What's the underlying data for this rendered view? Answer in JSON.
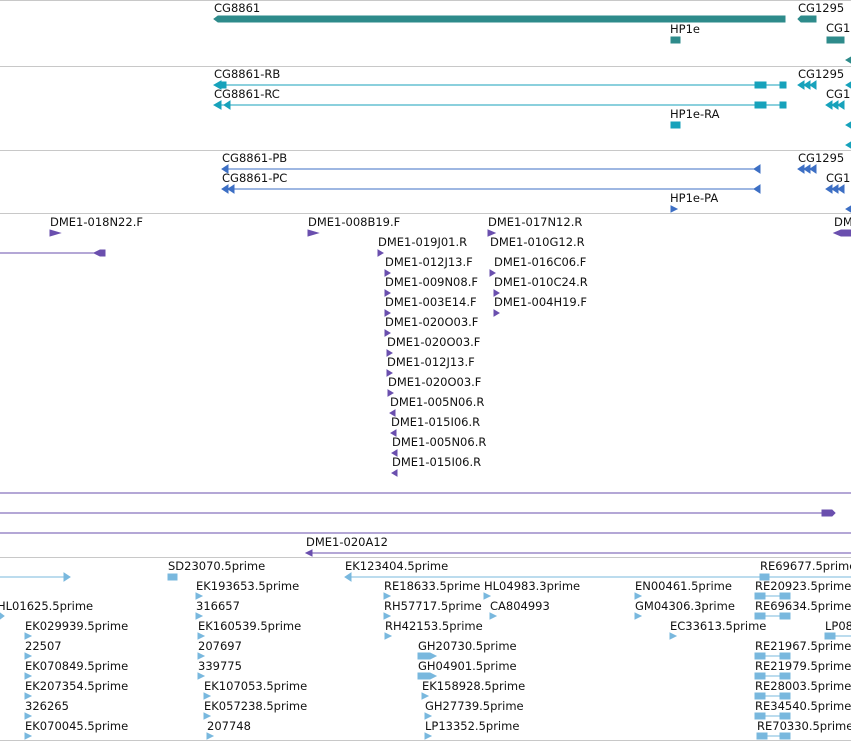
{
  "colors": {
    "gene": "#2e8b8b",
    "transcript": "#17a2bb",
    "protein": "#3d6fc4",
    "clone": "#6a4fae",
    "est": "#79b8de",
    "separator": "#c8c8c8"
  },
  "tracks": {
    "genes": {
      "labels": [
        {
          "id": "gene-cg8861",
          "text": "CG8861"
        },
        {
          "id": "gene-cg1295-a",
          "text": "CG1295"
        },
        {
          "id": "gene-hp1e",
          "text": "HP1e"
        },
        {
          "id": "gene-cg1-a",
          "text": "CG1"
        }
      ]
    },
    "transcripts": {
      "labels": [
        {
          "id": "tx-cg8861-rb",
          "text": "CG8861-RB"
        },
        {
          "id": "tx-cg1295-b",
          "text": "CG1295"
        },
        {
          "id": "tx-cg8861-rc",
          "text": "CG8861-RC"
        },
        {
          "id": "tx-cg1-b",
          "text": "CG1"
        },
        {
          "id": "tx-hp1e-ra",
          "text": "HP1e-RA"
        }
      ]
    },
    "proteins": {
      "labels": [
        {
          "id": "pp-cg8861-pb",
          "text": "CG8861-PB"
        },
        {
          "id": "pp-cg1295-c",
          "text": "CG1295"
        },
        {
          "id": "pp-cg8861-pc",
          "text": "CG8861-PC"
        },
        {
          "id": "pp-cg1-c",
          "text": "CG1"
        },
        {
          "id": "pp-hp1e-pa",
          "text": "HP1e-PA"
        }
      ]
    },
    "clones": {
      "labels": [
        {
          "id": "cl-018n22f",
          "text": "DME1-018N22.F"
        },
        {
          "id": "cl-008b19f",
          "text": "DME1-008B19.F"
        },
        {
          "id": "cl-017n12r",
          "text": "DME1-017N12.R"
        },
        {
          "id": "cl-dm-edge",
          "text": "DM"
        },
        {
          "id": "cl-019j01r",
          "text": "DME1-019J01.R"
        },
        {
          "id": "cl-010g12r",
          "text": "DME1-010G12.R"
        },
        {
          "id": "cl-012j13f-a",
          "text": "DME1-012J13.F"
        },
        {
          "id": "cl-016c06f",
          "text": "DME1-016C06.F"
        },
        {
          "id": "cl-009n08f",
          "text": "DME1-009N08.F"
        },
        {
          "id": "cl-010c24r",
          "text": "DME1-010C24.R"
        },
        {
          "id": "cl-003e14f",
          "text": "DME1-003E14.F"
        },
        {
          "id": "cl-004h19f",
          "text": "DME1-004H19.F"
        },
        {
          "id": "cl-020o03f-a",
          "text": "DME1-020O03.F"
        },
        {
          "id": "cl-020o03f-b",
          "text": "DME1-020O03.F"
        },
        {
          "id": "cl-012j13f-b",
          "text": "DME1-012J13.F"
        },
        {
          "id": "cl-020o03f-c",
          "text": "DME1-020O03.F"
        },
        {
          "id": "cl-005n06r-a",
          "text": "DME1-005N06.R"
        },
        {
          "id": "cl-015i06r-a",
          "text": "DME1-015I06.R"
        },
        {
          "id": "cl-005n06r-b",
          "text": "DME1-005N06.R"
        },
        {
          "id": "cl-015i06r-b",
          "text": "DME1-015I06.R"
        },
        {
          "id": "cl-020a12",
          "text": "DME1-020A12"
        }
      ]
    },
    "ests": {
      "labels": [
        {
          "id": "est-sd23070",
          "text": "SD23070.5prime"
        },
        {
          "id": "est-ek123404",
          "text": "EK123404.5prime"
        },
        {
          "id": "est-re69677",
          "text": "RE69677.5prime"
        },
        {
          "id": "est-hl01625",
          "text": "HL01625.5prime"
        },
        {
          "id": "est-ek193653",
          "text": "EK193653.5prime"
        },
        {
          "id": "est-re18633",
          "text": "RE18633.5prime"
        },
        {
          "id": "est-hl04983",
          "text": "HL04983.3prime"
        },
        {
          "id": "est-en00461",
          "text": "EN00461.5prime"
        },
        {
          "id": "est-re20923",
          "text": "RE20923.5prime"
        },
        {
          "id": "est-316657",
          "text": "316657"
        },
        {
          "id": "est-rh57717",
          "text": "RH57717.5prime"
        },
        {
          "id": "est-ca804993",
          "text": "CA804993"
        },
        {
          "id": "est-gm04306",
          "text": "GM04306.3prime"
        },
        {
          "id": "est-re69634",
          "text": "RE69634.5prime"
        },
        {
          "id": "est-ek029939",
          "text": "EK029939.5prime"
        },
        {
          "id": "est-ek160539",
          "text": "EK160539.5prime"
        },
        {
          "id": "est-rh42153",
          "text": "RH42153.5prime"
        },
        {
          "id": "est-ec33613",
          "text": "EC33613.5prime"
        },
        {
          "id": "est-lp08",
          "text": "LP08"
        },
        {
          "id": "est-22507",
          "text": "22507"
        },
        {
          "id": "est-207697",
          "text": "207697"
        },
        {
          "id": "est-gh20730",
          "text": "GH20730.5prime"
        },
        {
          "id": "est-re21967",
          "text": "RE21967.5prime"
        },
        {
          "id": "est-ek070849",
          "text": "EK070849.5prime"
        },
        {
          "id": "est-339775",
          "text": "339775"
        },
        {
          "id": "est-gh04901",
          "text": "GH04901.5prime"
        },
        {
          "id": "est-re21979",
          "text": "RE21979.5prime"
        },
        {
          "id": "est-ek207354",
          "text": "EK207354.5prime"
        },
        {
          "id": "est-ek107053",
          "text": "EK107053.5prime"
        },
        {
          "id": "est-ek158928",
          "text": "EK158928.5prime"
        },
        {
          "id": "est-re28003",
          "text": "RE28003.5prime"
        },
        {
          "id": "est-326265",
          "text": "326265"
        },
        {
          "id": "est-ek057238",
          "text": "EK057238.5prime"
        },
        {
          "id": "est-gh27739",
          "text": "GH27739.5prime"
        },
        {
          "id": "est-re34540",
          "text": "RE34540.5prime"
        },
        {
          "id": "est-ek070045",
          "text": "EK070045.5prime"
        },
        {
          "id": "est-207748",
          "text": "207748"
        },
        {
          "id": "est-lp13352",
          "text": "LP13352.5prime"
        },
        {
          "id": "est-re70330",
          "text": "RE70330.5prime"
        }
      ]
    }
  }
}
